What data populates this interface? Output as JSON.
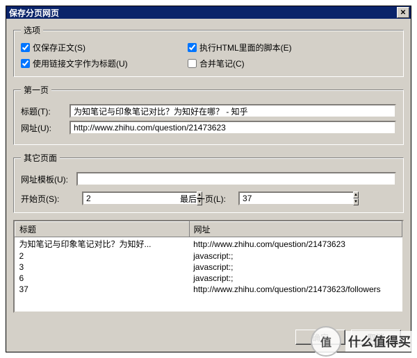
{
  "title": "保存分页网页",
  "options": {
    "legend": "选项",
    "save_body_only": {
      "label": "仅保存正文(S)",
      "checked": true,
      "underline": "S"
    },
    "run_scripts": {
      "label": "执行HTML里面的脚本(E)",
      "checked": true,
      "underline": "E"
    },
    "link_text_as_title": {
      "label": "使用链接文字作为标题(U)",
      "checked": true,
      "underline": "U"
    },
    "merge_notes": {
      "label": "合并笔记(C)",
      "checked": false,
      "underline": "C"
    }
  },
  "first_page": {
    "legend": "第一页",
    "title_label": "标题(T):",
    "title_value": "为知笔记与印象笔记对比？为知好在哪？ - 知乎",
    "url_label": "网址(U):",
    "url_value": "http://www.zhihu.com/question/21473623"
  },
  "other_pages": {
    "legend": "其它页面",
    "template_label": "网址模板(U):",
    "template_value": "",
    "start_label": "开始页(S):",
    "start_value": "2",
    "end_label": "最后一页(L):",
    "end_value": "37"
  },
  "list": {
    "col_title": "标题",
    "col_url": "网址",
    "rows": [
      {
        "t": "为知笔记与印象笔记对比？为知好...",
        "u": "http://www.zhihu.com/question/21473623"
      },
      {
        "t": "2",
        "u": "javascript:;"
      },
      {
        "t": "3",
        "u": "javascript:;"
      },
      {
        "t": "6",
        "u": "javascript:;"
      },
      {
        "t": "37",
        "u": "http://www.zhihu.com/question/21473623/followers"
      }
    ]
  },
  "buttons": {
    "ok": "确定",
    "cancel": "取消"
  },
  "watermark": {
    "badge": "值",
    "text": "什么值得买"
  }
}
